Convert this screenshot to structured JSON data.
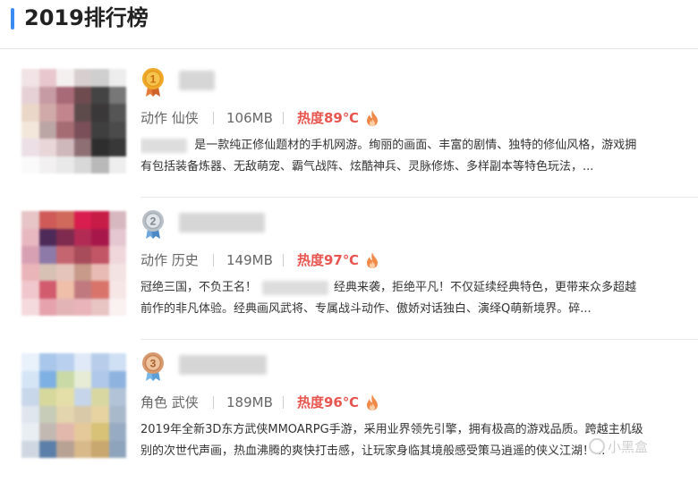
{
  "page": {
    "title": "2019排行榜",
    "accent_color": "#3b8cf2",
    "heat_color": "#e8554e"
  },
  "ranking": [
    {
      "rank": "1",
      "medal": "gold-medal-icon",
      "category": "动作 仙侠",
      "size": "106MB",
      "heat": "热度89℃",
      "desc_lines": [
        {
          "lead_blur": true,
          "text": "是一款纯正修仙题材的手机网游。绚丽的画面、丰富的剧情、独特的修仙风格，游戏拥"
        },
        {
          "lead_blur": false,
          "text": "有包括装备炼器、无敌萌宠、霸气战阵、炫酷神兵、灵脉修炼、多样副本等特色玩法，..."
        }
      ]
    },
    {
      "rank": "2",
      "medal": "silver-medal-icon",
      "category": "动作 历史",
      "size": "149MB",
      "heat": "热度97℃",
      "desc_lines": [
        {
          "pre": "冠绝三国，不负王名！",
          "post": "经典来袭，拒绝平凡！不仅延续经典特色，更带来众多超越"
        },
        {
          "text": "前作的非凡体验。经典画风武将、专属战斗动作、傲娇对话独白、演绎Q萌新境界。碎..."
        }
      ]
    },
    {
      "rank": "3",
      "medal": "bronze-medal-icon",
      "category": "角色 武侠",
      "size": "189MB",
      "heat": "热度96℃",
      "desc_lines": [
        {
          "text": "2019年全新3D东方武侠MMOARPG手游，采用业界领先引擎，拥有极高的游戏品质。跨越主机级"
        },
        {
          "text": "别的次世代声画，热血沸腾的爽快打击感，让玩家身临其境般感受策马逍遥的侠义江湖！..."
        }
      ]
    }
  ],
  "watermark": "小黑盒"
}
